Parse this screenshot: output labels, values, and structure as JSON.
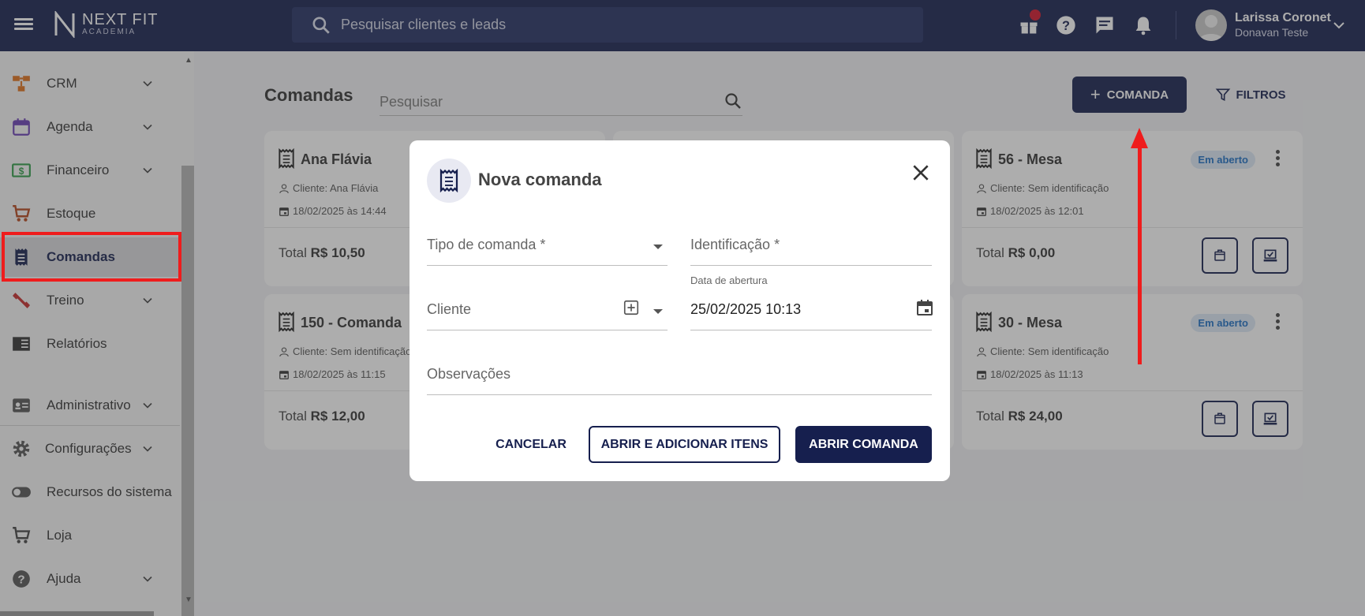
{
  "app": {
    "logo_main": "NEXT FIT",
    "logo_sub": "ACADEMIA"
  },
  "topbar": {
    "search_placeholder": "Pesquisar clientes e leads",
    "user_name": "Larissa Coronet",
    "user_subtitle": "Donavan Teste",
    "accent_color": "#161f4e",
    "notification_dot_color": "#d3132a"
  },
  "sidebar": {
    "items": [
      {
        "label": "CRM",
        "icon": "crm-icon",
        "has_children": true
      },
      {
        "label": "Agenda",
        "icon": "calendar-icon",
        "has_children": true
      },
      {
        "label": "Financeiro",
        "icon": "money-icon",
        "has_children": true
      },
      {
        "label": "Estoque",
        "icon": "cart-icon",
        "has_children": false
      },
      {
        "label": "Comandas",
        "icon": "receipt-icon",
        "has_children": false,
        "active": true
      },
      {
        "label": "Treino",
        "icon": "dumbbell-icon",
        "has_children": true
      },
      {
        "label": "Relatórios",
        "icon": "report-icon",
        "has_children": false
      },
      {
        "label": "Administrativo",
        "icon": "id-card-icon",
        "has_children": true
      },
      {
        "label": "Configurações",
        "icon": "gear-icon",
        "has_children": true
      },
      {
        "label": "Recursos do sistema",
        "icon": "toggle-icon",
        "has_children": false
      },
      {
        "label": "Loja",
        "icon": "cart-icon",
        "has_children": false
      },
      {
        "label": "Ajuda",
        "icon": "help-icon",
        "has_children": true
      }
    ]
  },
  "main": {
    "title": "Comandas",
    "search_placeholder": "Pesquisar",
    "new_button": "COMANDA",
    "filters_button": "FILTROS",
    "cards": [
      {
        "title": "Ana Flávia",
        "client": "Cliente: Ana Flávia",
        "date": "18/02/2025 às 14:44",
        "total_label": "Total",
        "total_value": "R$ 10,50"
      },
      {
        "title": "56 - Mesa",
        "client": "Cliente: Sem identificação",
        "date": "18/02/2025 às 12:01",
        "total_label": "Total",
        "total_value": "R$ 0,00",
        "status": "Em aberto"
      },
      {
        "title": "150 - Comanda",
        "client": "Cliente: Sem identificação",
        "date": "18/02/2025 às 11:15",
        "total_label": "Total",
        "total_value": "R$ 12,00"
      },
      {
        "title": "30 - Mesa",
        "client": "Cliente: Sem identificação",
        "date": "18/02/2025 às 11:13",
        "total_label": "Total",
        "total_value": "R$ 24,00",
        "status": "Em aberto"
      }
    ]
  },
  "modal": {
    "title": "Nova comanda",
    "tipo_label": "Tipo de comanda *",
    "identificacao_label": "Identificação *",
    "cliente_label": "Cliente",
    "data_label": "Data de abertura",
    "data_value": "25/02/2025 10:13",
    "observacoes_label": "Observações",
    "cancel": "CANCELAR",
    "open_add": "ABRIR E ADICIONAR ITENS",
    "open": "ABRIR COMANDA"
  }
}
